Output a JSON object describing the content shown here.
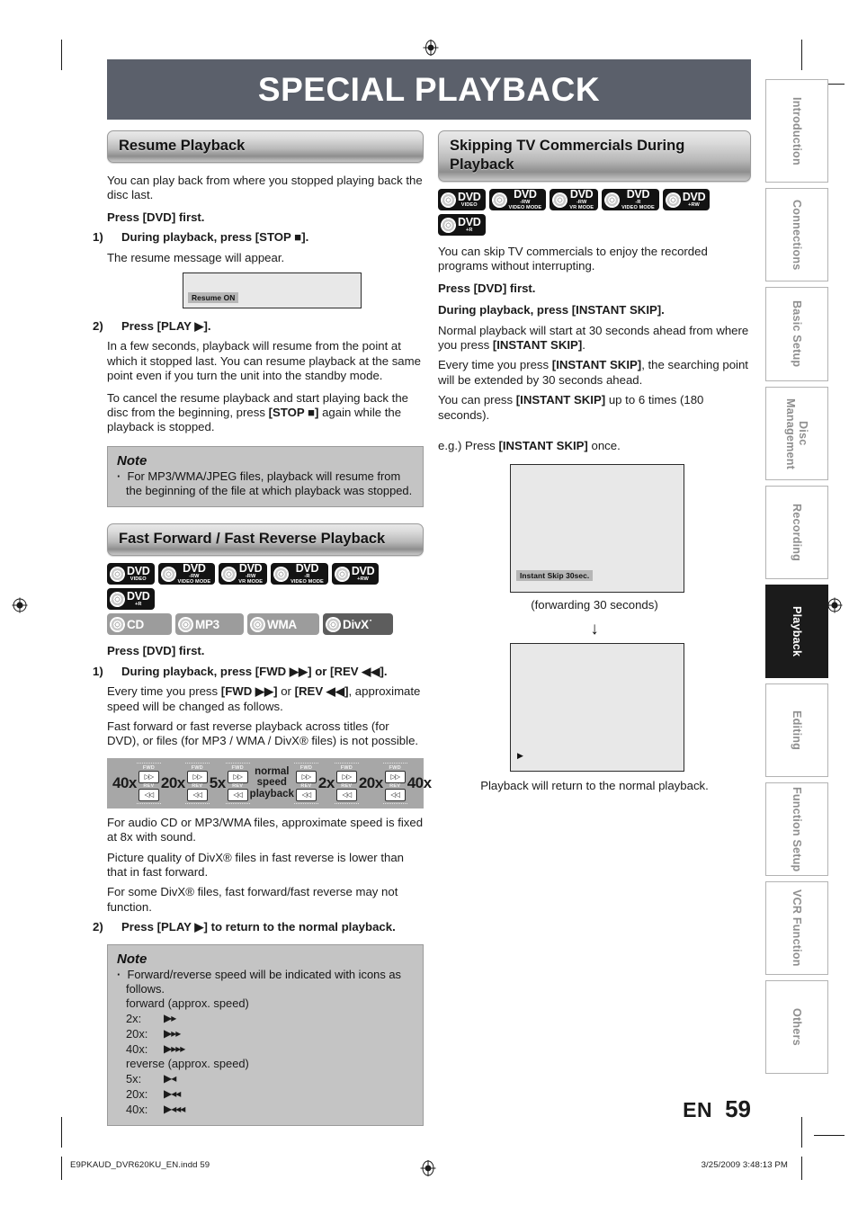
{
  "document": {
    "title": "SPECIAL PLAYBACK",
    "page_number": "59",
    "language_code": "EN"
  },
  "left_column": {
    "section1": {
      "heading": "Resume Playback",
      "intro": "You can play back from where you stopped playing back the disc last.",
      "press_first": "Press [DVD] first.",
      "step1_num": "1)",
      "step1": "During playback, press [STOP ■].",
      "step1_body": "The resume message will appear.",
      "screen_osd": "Resume ON",
      "step2_num": "2)",
      "step2": "Press [PLAY ▶].",
      "step2_body1": "In a few seconds, playback will resume from the point at which it stopped last. You can resume playback at the same point even if you turn the unit into the standby mode.",
      "step2_body2_a": "To cancel the resume playback and start playing back the disc from the beginning, press ",
      "step2_body2_b": "[STOP ■]",
      "step2_body2_c": " again while the playback is stopped.",
      "note_title": "Note",
      "note_items": [
        "For MP3/WMA/JPEG files, playback will resume from the beginning of the file at which playback was stopped."
      ]
    },
    "section2": {
      "heading": "Fast Forward / Fast Reverse Playback",
      "discs_row1": [
        {
          "l1": "DVD",
          "l2": "Video",
          "style": "black"
        },
        {
          "l1": "DVD",
          "l2": "-RW\nVideo Mode",
          "style": "black"
        },
        {
          "l1": "DVD",
          "l2": "-RW\nVR MODE",
          "style": "black"
        },
        {
          "l1": "DVD",
          "l2": "-R\nVideo Mode",
          "style": "black"
        },
        {
          "l1": "DVD",
          "l2": "+RW",
          "style": "black"
        },
        {
          "l1": "DVD",
          "l2": "+R",
          "style": "black"
        }
      ],
      "discs_row2": [
        {
          "l1": "CD",
          "l2": "",
          "style": "grey"
        },
        {
          "l1": "MP3",
          "l2": "",
          "style": "grey"
        },
        {
          "l1": "WMA",
          "l2": "",
          "style": "grey"
        },
        {
          "l1": "DivX˙",
          "l2": "",
          "style": "dgrey"
        }
      ],
      "press_first": "Press [DVD] first.",
      "step1_num": "1)",
      "step1": "During playback, press [FWD ▶▶] or [REV ◀◀].",
      "step1_body1_a": "Every time you press ",
      "step1_body1_b": "[FWD ▶▶]",
      "step1_body1_c": " or ",
      "step1_body1_d": "[REV ◀◀]",
      "step1_body1_e": ", approximate speed will be changed as follows.",
      "step1_body2": "Fast forward or fast reverse playback across titles (for DVD), or files (for MP3 / WMA / DivX® files) is not possible.",
      "speed_diagram": {
        "labels": [
          "40x",
          "20x",
          "5x",
          "normal speed playback",
          "2x",
          "20x",
          "40x"
        ],
        "key_fwd_label": "FWD",
        "key_rev_label": "REV",
        "key_fwd_glyph": "▶▶",
        "key_rev_glyph": "◀◀",
        "key_count": 6
      },
      "after1": "For audio CD or MP3/WMA files, approximate speed is fixed at 8x with sound.",
      "after2": "Picture quality of DivX® files in fast reverse is lower than that in fast forward.",
      "after3": "For some DivX® files, fast forward/fast reverse may not function.",
      "step2_num": "2)",
      "step2": "Press [PLAY ▶] to return to the normal playback.",
      "note_title": "Note",
      "note_lead": "Forward/reverse speed will be indicated with icons as follows.",
      "note_fwd_header": "forward (approx. speed)",
      "note_fwd": [
        {
          "speed": "2x:",
          "glyph": "▶▸"
        },
        {
          "speed": "20x:",
          "glyph": "▶▸▸"
        },
        {
          "speed": "40x:",
          "glyph": "▶▸▸▸"
        }
      ],
      "note_rev_header": "reverse (approx. speed)",
      "note_rev": [
        {
          "speed": "5x:",
          "glyph": "▶◂"
        },
        {
          "speed": "20x:",
          "glyph": "▶◂◂"
        },
        {
          "speed": "40x:",
          "glyph": "▶◂◂◂"
        }
      ]
    }
  },
  "right_column": {
    "section1": {
      "heading": "Skipping TV Commercials During Playback",
      "discs_row1": [
        {
          "l1": "DVD",
          "l2": "Video",
          "style": "black"
        },
        {
          "l1": "DVD",
          "l2": "-RW\nVideo Mode",
          "style": "black"
        },
        {
          "l1": "DVD",
          "l2": "-RW\nVR MODE",
          "style": "black"
        },
        {
          "l1": "DVD",
          "l2": "-R\nVideo Mode",
          "style": "black"
        },
        {
          "l1": "DVD",
          "l2": "+RW",
          "style": "black"
        },
        {
          "l1": "DVD",
          "l2": "+R",
          "style": "black"
        }
      ],
      "intro": "You can skip TV commercials to enjoy the recorded programs without interrupting.",
      "press_first": "Press [DVD] first.",
      "instruction": "During playback, press [INSTANT SKIP].",
      "body1_a": "Normal playback will start at 30 seconds ahead from where you press ",
      "body1_b": "[INSTANT SKIP]",
      "body1_c": ".",
      "body2_a": "Every time you press ",
      "body2_b": "[INSTANT SKIP]",
      "body2_c": ", the searching point will be extended by 30 seconds ahead.",
      "body3_a": "You can press ",
      "body3_b": "[INSTANT SKIP]",
      "body3_c": " up to 6 times (180 seconds).",
      "example_a": "e.g.) Press ",
      "example_b": "[INSTANT SKIP]",
      "example_c": " once.",
      "screen1_osd": "Instant Skip 30sec.",
      "caption1": "(forwarding 30 seconds)",
      "arrow_glyph": "↓",
      "screen2_osd": "▶",
      "caption2": "Playback will return to the normal playback."
    }
  },
  "side_tabs": [
    {
      "label": "Introduction",
      "active": false
    },
    {
      "label": "Connections",
      "active": false
    },
    {
      "label": "Basic Setup",
      "active": false
    },
    {
      "label": "Disc Management",
      "active": false
    },
    {
      "label": "Recording",
      "active": false
    },
    {
      "label": "Playback",
      "active": true
    },
    {
      "label": "Editing",
      "active": false
    },
    {
      "label": "Function Setup",
      "active": false
    },
    {
      "label": "VCR Function",
      "active": false
    },
    {
      "label": "Others",
      "active": false
    }
  ],
  "footer": {
    "left": "E9PKAUD_DVR620KU_EN.indd   59",
    "right": "3/25/2009   3:48:13 PM"
  },
  "colors": {
    "title_band": "#5b606b",
    "note_bg": "#c4c4c4",
    "speedbar_bg": "#a7a7a7",
    "screen_bg": "#e8e8e8",
    "badge_black": "#131313",
    "badge_grey": "#9c9c9c",
    "badge_dark_grey": "#5d5d5d",
    "active_tab": "#1b1b1b"
  }
}
